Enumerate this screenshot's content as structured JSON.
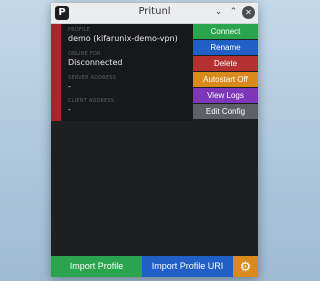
{
  "window": {
    "app_icon": "P",
    "title": "Pritunl",
    "controls": {
      "minimize": "⌄",
      "maximize": "⌃",
      "close": "✕"
    }
  },
  "profile": {
    "name_label": "PROFILE",
    "name": "demo (kifarunix-demo-vpn)",
    "status_label": "ONLINE FOR",
    "status": "Disconnected",
    "server_address_label": "SERVER ADDRESS",
    "server_address": "-",
    "client_address_label": "CLIENT ADDRESS",
    "client_address": "-",
    "accent_color": "#a7262e"
  },
  "menu": {
    "connect": "Connect",
    "rename": "Rename",
    "delete": "Delete",
    "autostart": "Autostart Off",
    "view_logs": "View Logs",
    "edit_config": "Edit Config"
  },
  "footer": {
    "import_profile": "Import Profile",
    "import_profile_uri": "Import Profile URI",
    "settings_icon": "gear-icon"
  },
  "colors": {
    "connect": "#2ba44e",
    "rename": "#1f5fc6",
    "delete": "#b53131",
    "autostart": "#d98a1c",
    "view_logs": "#7d37b8",
    "edit_config": "#5d6065",
    "import_profile": "#2ba44e",
    "import_profile_uri": "#1f5fc6",
    "settings": "#d98a1c"
  }
}
